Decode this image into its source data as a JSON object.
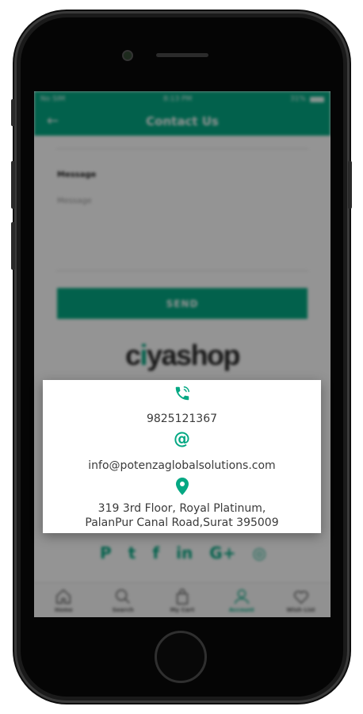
{
  "status_bar": {
    "carrier": "No SIM",
    "time": "8:13 PM",
    "battery": "31%"
  },
  "header": {
    "title": "Contact Us"
  },
  "form": {
    "message_label": "Message",
    "message_placeholder": "Message",
    "send_label": "SEND"
  },
  "brand": {
    "logo_prefix": "c",
    "logo_dot": "i",
    "logo_suffix": "yashop"
  },
  "social": [
    {
      "name": "pinterest-icon",
      "glyph": "P"
    },
    {
      "name": "twitter-icon",
      "glyph": "t"
    },
    {
      "name": "facebook-icon",
      "glyph": "f"
    },
    {
      "name": "linkedin-icon",
      "glyph": "in"
    },
    {
      "name": "google-plus-icon",
      "glyph": "G+"
    },
    {
      "name": "instagram-icon",
      "glyph": "◎"
    }
  ],
  "tabs": [
    {
      "label": "Home",
      "icon": "home-icon"
    },
    {
      "label": "Search",
      "icon": "search-icon"
    },
    {
      "label": "My Cart",
      "icon": "cart-icon"
    },
    {
      "label": "Account",
      "icon": "account-icon",
      "active": true
    },
    {
      "label": "Wish List",
      "icon": "heart-icon"
    }
  ],
  "contact": {
    "phone": "9825121367",
    "email": "info@potenzaglobalsolutions.com",
    "address_line1": "319 3rd Floor, Royal Platinum,",
    "address_line2": "PalanPur Canal Road,Surat 395009"
  },
  "colors": {
    "accent": "#04a883",
    "overlay": "rgba(0,0,0,0.42)"
  }
}
